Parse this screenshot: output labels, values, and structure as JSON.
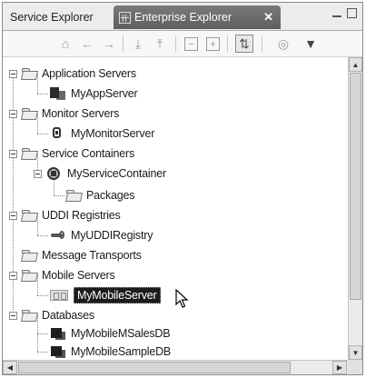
{
  "tabs": {
    "service_explorer": "Service Explorer",
    "enterprise_explorer": "Enterprise Explorer",
    "close_glyph": "✕"
  },
  "window_buttons": {
    "minimize": "minimize-icon",
    "maximize": "maximize-icon"
  },
  "toolbar": {
    "icons": [
      "home-icon",
      "back-icon",
      "forward-icon",
      "import-icon",
      "export-icon",
      "collapse-all-icon",
      "expand-all-icon",
      "link-with-editor-icon",
      "filter-icon",
      "view-menu-icon"
    ]
  },
  "tree": {
    "application_servers": {
      "label": "Application Servers",
      "children": [
        "MyAppServer"
      ]
    },
    "monitor_servers": {
      "label": "Monitor Servers",
      "children": [
        "MyMonitorServer"
      ]
    },
    "service_containers": {
      "label": "Service Containers",
      "children": [
        {
          "label": "MyServiceContainer",
          "children": [
            "Packages"
          ]
        }
      ]
    },
    "uddi_registries": {
      "label": "UDDI Registries",
      "children": [
        "MyUDDIRegistry"
      ]
    },
    "message_transports": {
      "label": "Message Transports",
      "children": []
    },
    "mobile_servers": {
      "label": "Mobile Servers",
      "children": [
        "MyMobileServer"
      ],
      "selected": "MyMobileServer"
    },
    "databases": {
      "label": "Databases",
      "children": [
        "MyMobileMSalesDB",
        "MyMobileSampleDB"
      ]
    }
  },
  "colors": {
    "active_tab": "#666666",
    "selection": "#1c1c1c",
    "tree_line": "#8a8a8a"
  }
}
